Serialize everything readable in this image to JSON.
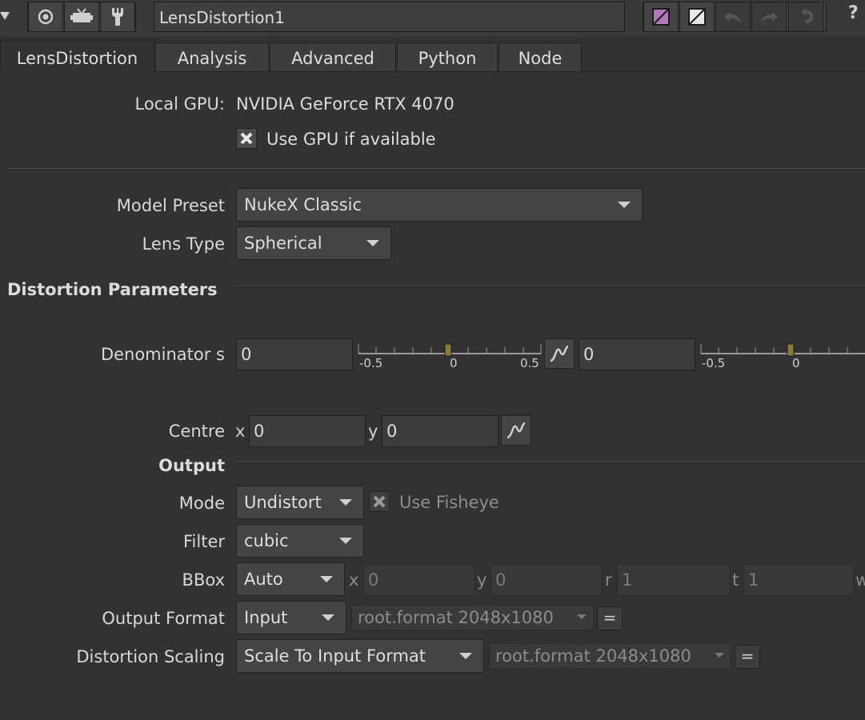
{
  "toolbar": {
    "node_name": "LensDistortion1",
    "help": "?",
    "icons": [
      "collapse-arrow-icon",
      "viewer-icon",
      "tv-icon",
      "wrench-icon",
      "pink-color-swatch-icon",
      "white-color-swatch-icon",
      "undo-icon",
      "redo-icon",
      "revert-icon"
    ],
    "colors": {
      "pink_swatch": "#b07ab8",
      "white_swatch": "#e8e8e8"
    }
  },
  "tabs": [
    {
      "label": "LensDistortion",
      "active": true
    },
    {
      "label": "Analysis"
    },
    {
      "label": "Advanced"
    },
    {
      "label": "Python"
    },
    {
      "label": "Node"
    }
  ],
  "gpu": {
    "label": "Local GPU:",
    "value": "NVIDIA GeForce RTX 4070",
    "use_gpu_label": "Use GPU if available",
    "use_gpu_checked": true
  },
  "model_preset": {
    "label": "Model Preset",
    "value": "NukeX Classic"
  },
  "lens_type": {
    "label": "Lens Type",
    "value": "Spherical"
  },
  "distortion": {
    "section": "Distortion Parameters",
    "denominator_label": "Denominator s",
    "value1": "0",
    "value2": "0",
    "slider1": {
      "min": "-0.5",
      "mid": "0",
      "max": "0.5",
      "position": 0.5
    },
    "slider2": {
      "min": "-0.5",
      "mid": "0",
      "position": 0.5
    },
    "slider_handle_color": "#8a7a3a"
  },
  "centre": {
    "label": "Centre",
    "x_label": "x",
    "x": "0",
    "y_label": "y",
    "y": "0"
  },
  "output": {
    "section": "Output",
    "mode_label": "Mode",
    "mode": "Undistort",
    "fisheye_label": "Use Fisheye",
    "fisheye_checked": true,
    "filter_label": "Filter",
    "filter": "cubic",
    "bbox_label": "BBox",
    "bbox": "Auto",
    "bbox_x_label": "x",
    "bbox_x": "0",
    "bbox_y_label": "y",
    "bbox_y": "0",
    "bbox_r_label": "r",
    "bbox_r": "1",
    "bbox_t_label": "t",
    "bbox_t": "1",
    "bbox_w_label": "w",
    "format_label": "Output Format",
    "format": "Input",
    "format_root": "root.format 2048x1080",
    "eq_label": "=",
    "scaling_label": "Distortion Scaling",
    "scaling": "Scale To Input Format",
    "scaling_root": "root.format 2048x1080"
  }
}
